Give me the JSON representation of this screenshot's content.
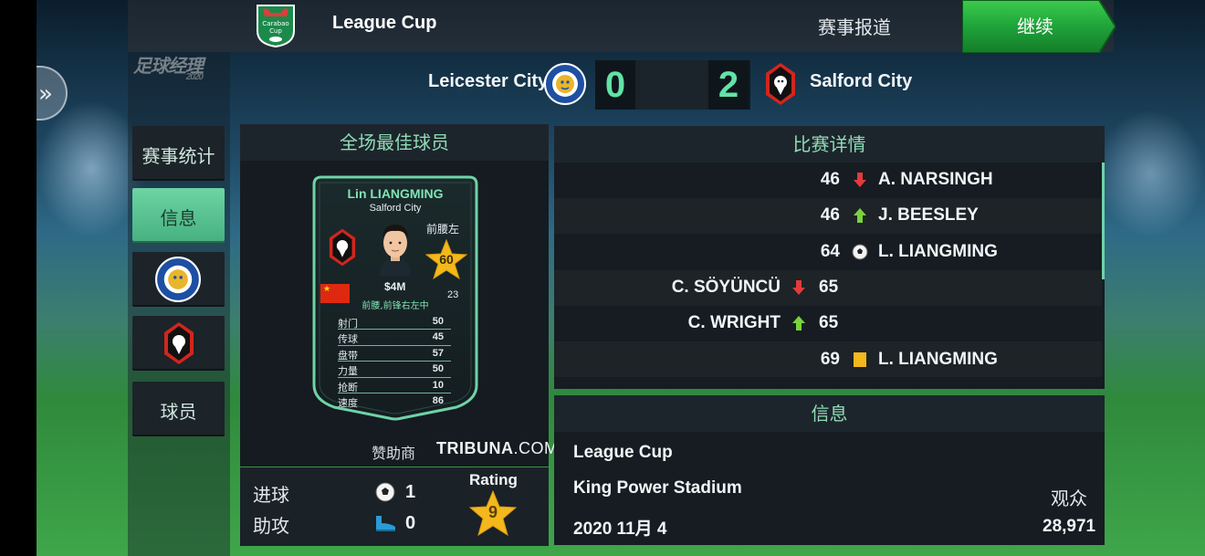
{
  "header": {
    "competition": "League Cup",
    "report_link": "赛事报道",
    "continue_label": "继续",
    "game_logo": "足球经理",
    "game_logo_year": "2020"
  },
  "match": {
    "home_team": "Leicester City",
    "away_team": "Salford City",
    "home_score": "0",
    "away_score": "2"
  },
  "sidebar": {
    "items": [
      {
        "label": "赛事统计",
        "active": false
      },
      {
        "label": "信息",
        "active": true
      },
      {
        "label": "",
        "crest": "leicester-crest"
      },
      {
        "label": "",
        "crest": "salford-crest"
      },
      {
        "label": "球员",
        "active": false
      }
    ]
  },
  "mvp": {
    "title": "全场最佳球员",
    "player_name": "Lin LIANGMING",
    "club": "Salford City",
    "position": "前腰左",
    "rating": "60",
    "value": "$4M",
    "age": "23",
    "roles": "前腰,前锋右左中",
    "stats": [
      {
        "name": "射门",
        "value": "50"
      },
      {
        "name": "传球",
        "value": "45"
      },
      {
        "name": "盘带",
        "value": "57"
      },
      {
        "name": "力量",
        "value": "50"
      },
      {
        "name": "抢断",
        "value": "10"
      },
      {
        "name": "速度",
        "value": "86"
      }
    ],
    "sponsor_label": "赞助商",
    "sponsor_name": "TRIBUNA",
    "sponsor_tld": ".COM",
    "goals_label": "进球",
    "goals": "1",
    "assists_label": "助攻",
    "assists": "0",
    "rating_label": "Rating",
    "match_rating": "9"
  },
  "details": {
    "title": "比赛详情",
    "events": [
      {
        "minute": "46",
        "player": "A. NARSINGH",
        "type": "sub-off",
        "side": "away"
      },
      {
        "minute": "46",
        "player": "J. BEESLEY",
        "type": "sub-on",
        "side": "away"
      },
      {
        "minute": "64",
        "player": "L. LIANGMING",
        "type": "goal",
        "side": "away"
      },
      {
        "minute": "65",
        "player": "C. SÖYÜNCÜ",
        "type": "sub-off",
        "side": "home"
      },
      {
        "minute": "65",
        "player": "C. WRIGHT",
        "type": "sub-on",
        "side": "home"
      },
      {
        "minute": "69",
        "player": "L. LIANGMING",
        "type": "yellow-card",
        "side": "away"
      }
    ]
  },
  "info": {
    "title": "信息",
    "competition": "League Cup",
    "stadium": "King Power Stadium",
    "date": "2020 11月 4",
    "attendance_label": "观众",
    "attendance": "28,971"
  },
  "colors": {
    "accent": "#61e3a6",
    "panel": "#161c21",
    "button_green": "#1fa33a",
    "star_gold": "#f3b81c"
  }
}
